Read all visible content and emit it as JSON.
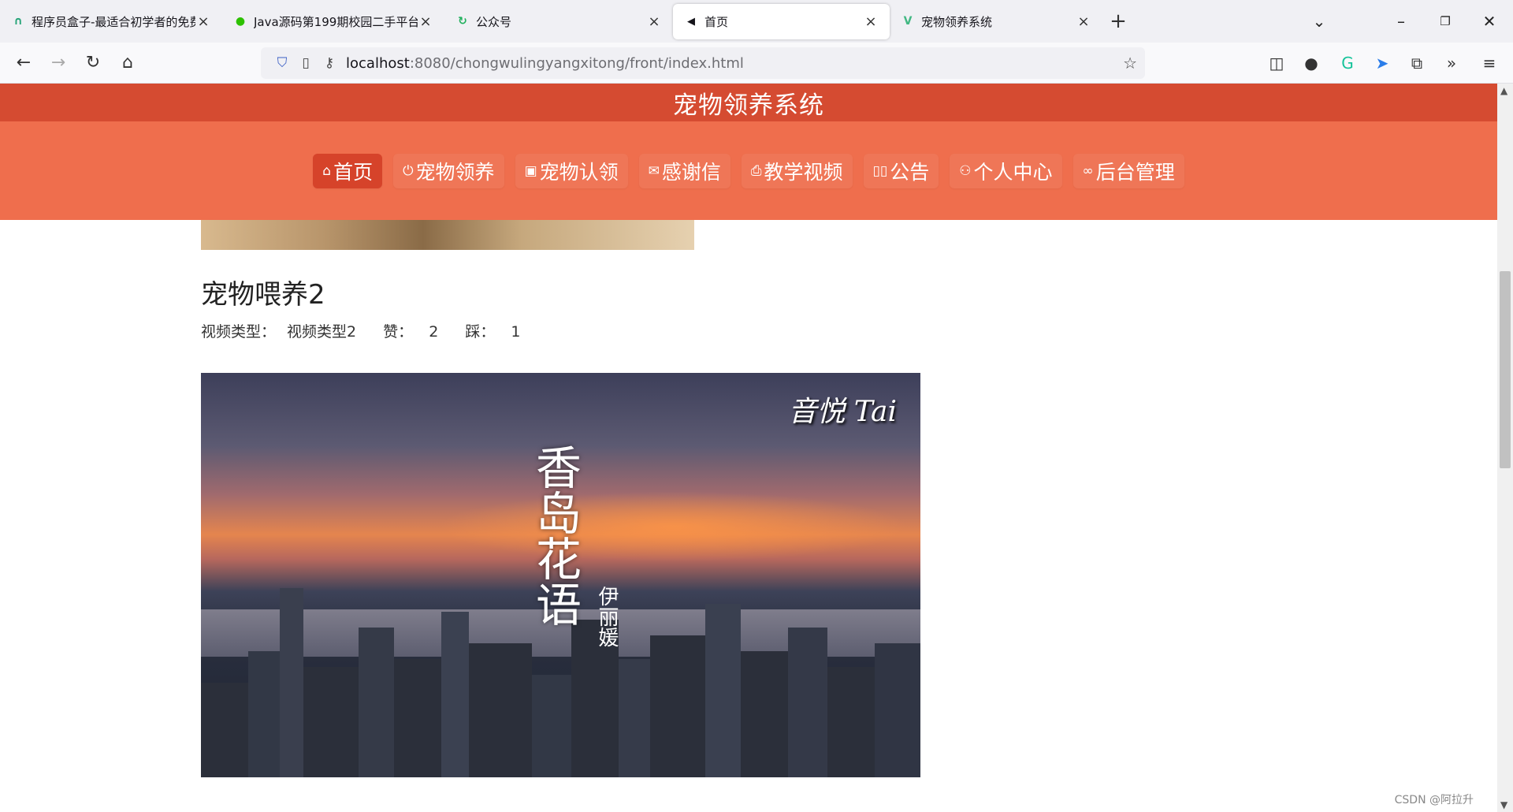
{
  "browser": {
    "tabs": [
      {
        "title": "程序员盒子-最适合初学者的免费",
        "favicon": "box-logo",
        "active": false
      },
      {
        "title": "Java源码第199期校园二手平台",
        "favicon": "wechat-logo",
        "active": false
      },
      {
        "title": "公众号",
        "favicon": "share-logo",
        "active": false
      },
      {
        "title": "首页",
        "favicon": "speaker-icon",
        "active": true
      },
      {
        "title": "宠物领养系统",
        "favicon": "vue-logo",
        "active": false
      }
    ],
    "url_host": "localhost",
    "url_rest": ":8080/chongwulingyangxitong/front/index.html"
  },
  "site": {
    "title": "宠物领养系统",
    "menu": [
      {
        "label": "首页",
        "icon": "home-icon",
        "active": true
      },
      {
        "label": "宠物领养",
        "icon": "power-icon",
        "active": false
      },
      {
        "label": "宠物认领",
        "icon": "gift-icon",
        "active": false
      },
      {
        "label": "感谢信",
        "icon": "mail-icon",
        "active": false
      },
      {
        "label": "教学视频",
        "icon": "printer-icon",
        "active": false
      },
      {
        "label": "公告",
        "icon": "book-icon",
        "active": false
      },
      {
        "label": "个人中心",
        "icon": "user-icon",
        "active": false
      },
      {
        "label": "后台管理",
        "icon": "link-icon",
        "active": false
      }
    ]
  },
  "item": {
    "title": "宠物喂养2",
    "type_label": "视频类型：",
    "type_value": "视频类型2",
    "like_label": "赞：",
    "like_value": "2",
    "dislike_label": "踩：",
    "dislike_value": "1"
  },
  "video": {
    "watermark": "音悦 Tai",
    "poem": "香岛花语",
    "poem_sub": "伊丽媛"
  },
  "footer_mark": "CSDN @阿拉升"
}
